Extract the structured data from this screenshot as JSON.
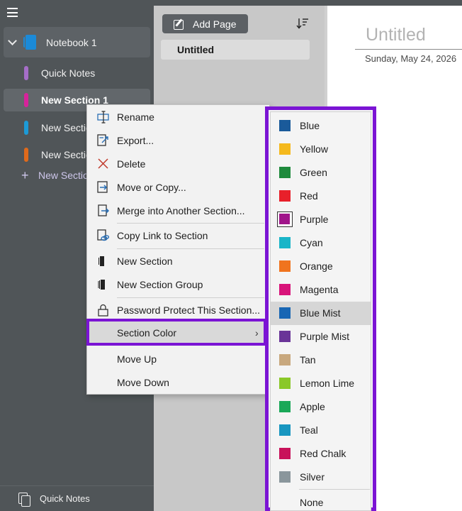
{
  "nav": {
    "notebook_name": "Notebook 1",
    "sections": [
      {
        "label": "Quick Notes",
        "color": "#a66ec8"
      },
      {
        "label": "New Section 1",
        "color": "#d6239b"
      },
      {
        "label": "New Section",
        "color": "#1c9ad6"
      },
      {
        "label": "New Section",
        "color": "#e06a1b"
      }
    ],
    "add_section_label": "New Section",
    "bottom_label": "Quick Notes"
  },
  "page_list": {
    "add_page_label": "Add Page",
    "pages": [
      "Untitled"
    ]
  },
  "canvas": {
    "title": "Untitled",
    "date": "Sunday, May 24, 2026"
  },
  "context_menu": {
    "rename": "Rename",
    "export": "Export...",
    "delete": "Delete",
    "move_copy": "Move or Copy...",
    "merge": "Merge into Another Section...",
    "copy_link": "Copy Link to Section",
    "new_section": "New Section",
    "new_section_group": "New Section Group",
    "password": "Password Protect This Section...",
    "section_color": "Section Color",
    "section_color_arrow": "›",
    "move_up": "Move Up",
    "move_down": "Move Down"
  },
  "color_menu": {
    "colors": [
      {
        "label": "Blue",
        "color": "#1a5a9a"
      },
      {
        "label": "Yellow",
        "color": "#f5b91d"
      },
      {
        "label": "Green",
        "color": "#1e8a3c"
      },
      {
        "label": "Red",
        "color": "#e8202a"
      },
      {
        "label": "Purple",
        "color": "#a0148a"
      },
      {
        "label": "Cyan",
        "color": "#1ab5c8"
      },
      {
        "label": "Orange",
        "color": "#f0741e"
      },
      {
        "label": "Magenta",
        "color": "#d8147a"
      },
      {
        "label": "Blue Mist",
        "color": "#1866b4"
      },
      {
        "label": "Purple Mist",
        "color": "#6a3498"
      },
      {
        "label": "Tan",
        "color": "#c8a87e"
      },
      {
        "label": "Lemon Lime",
        "color": "#8ac828"
      },
      {
        "label": "Apple",
        "color": "#1aa858"
      },
      {
        "label": "Teal",
        "color": "#1896c0"
      },
      {
        "label": "Red Chalk",
        "color": "#c8125a"
      },
      {
        "label": "Silver",
        "color": "#8a969c"
      }
    ],
    "none_label": "None",
    "hovered": "Blue Mist",
    "current": "Purple"
  },
  "accent": "#7b14d4"
}
